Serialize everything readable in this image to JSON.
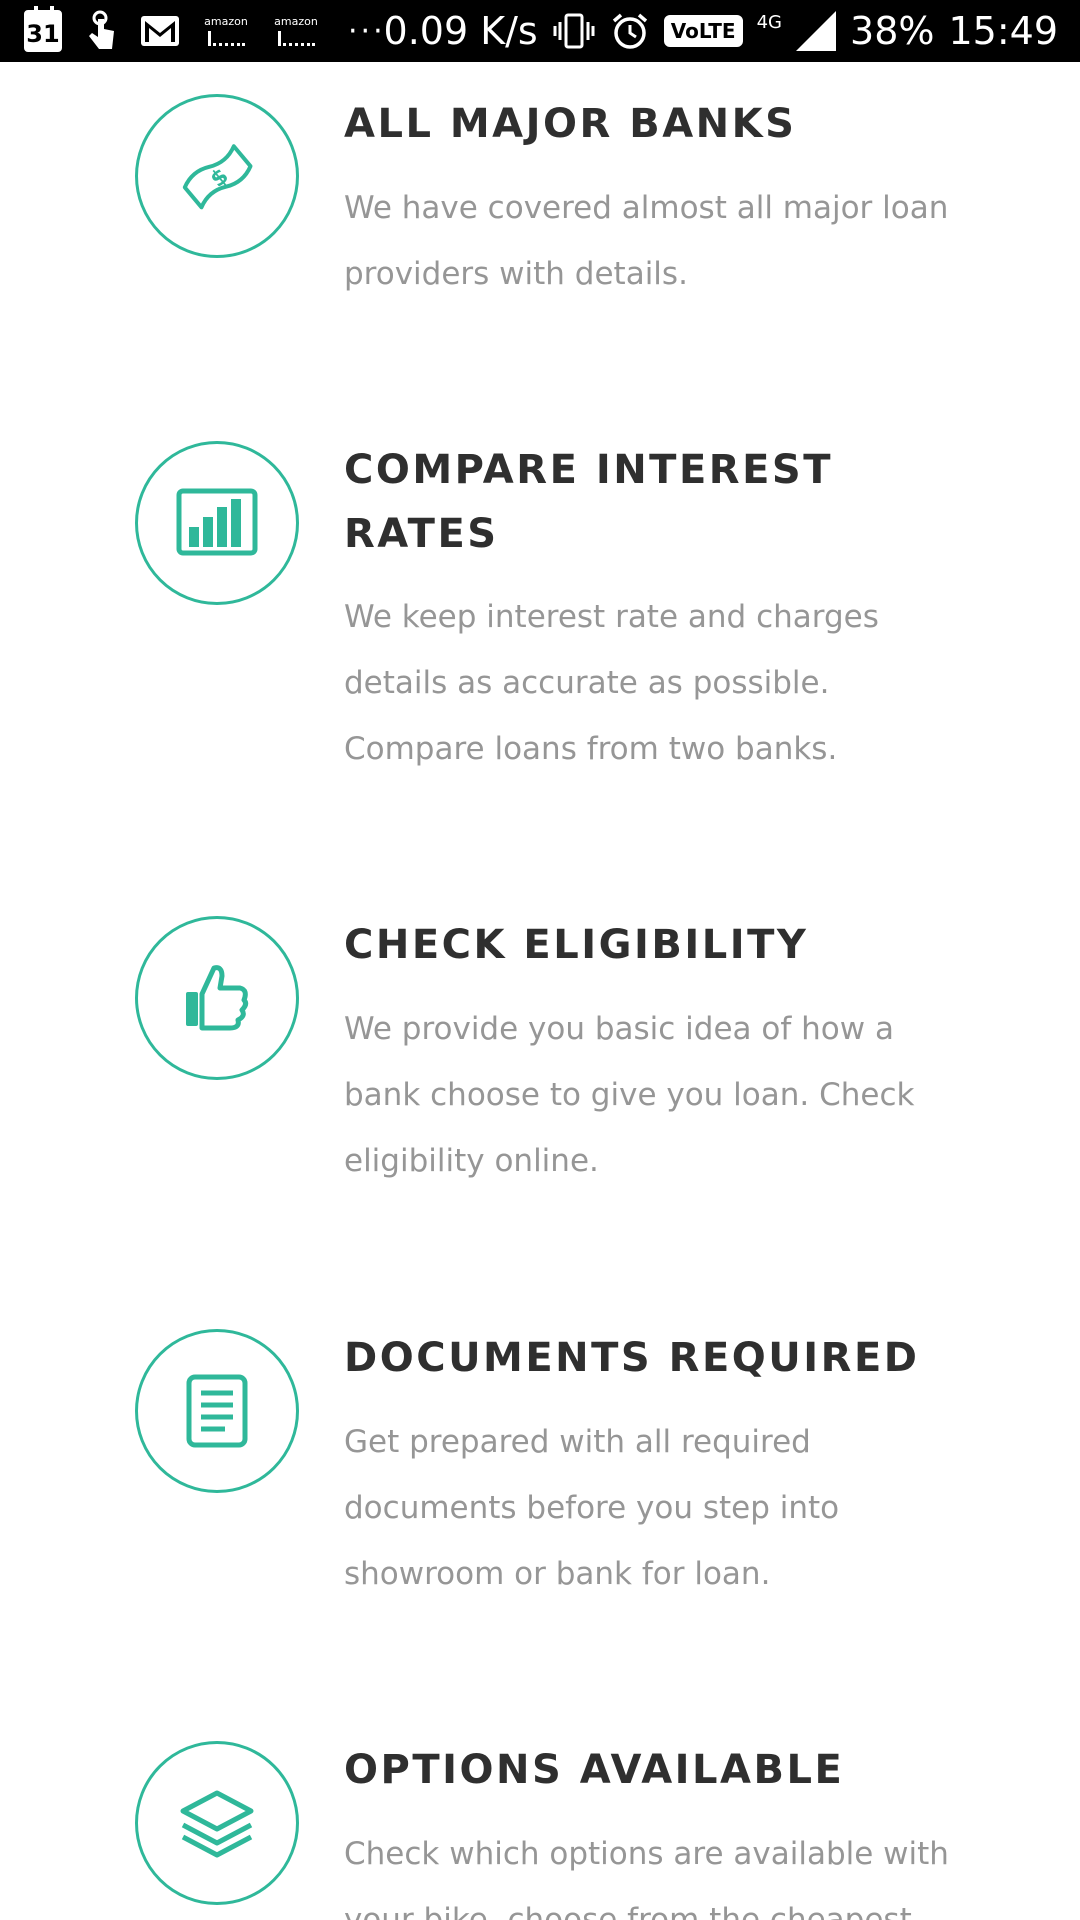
{
  "status_bar": {
    "calendar_day": "31",
    "amazon_label_1": "amazon",
    "amazon_label_2": "amazon",
    "more": "···",
    "speed": "0.09 K/s",
    "volte": "VoLTE",
    "network": "4G",
    "battery": "38%",
    "time": "15:49",
    "icons": [
      "calendar-icon",
      "touch-icon",
      "gmail-icon",
      "amazon-icon",
      "amazon-icon",
      "vibrate-icon",
      "alarm-icon",
      "signal-icon"
    ]
  },
  "accent_color": "#2fb89a",
  "features": [
    {
      "icon": "money-bill-icon",
      "title": "ALL MAJOR BANKS",
      "description": "We have covered almost all major loan providers with details."
    },
    {
      "icon": "bar-chart-icon",
      "title": "COMPARE INTEREST RATES",
      "description": "We keep interest rate and charges details as accurate as possible. Compare loans from two banks."
    },
    {
      "icon": "thumbs-up-icon",
      "title": "CHECK ELIGIBILITY",
      "description": "We provide you basic idea of how a bank choose to give you loan. Check eligibility online."
    },
    {
      "icon": "document-icon",
      "title": "DOCUMENTS REQUIRED",
      "description": "Get prepared with all required documents before you step into showroom or bank for loan."
    },
    {
      "icon": "layers-icon",
      "title": "OPTIONS AVAILABLE",
      "description": "Check which options are available with your bike, choose from the cheapest"
    }
  ]
}
